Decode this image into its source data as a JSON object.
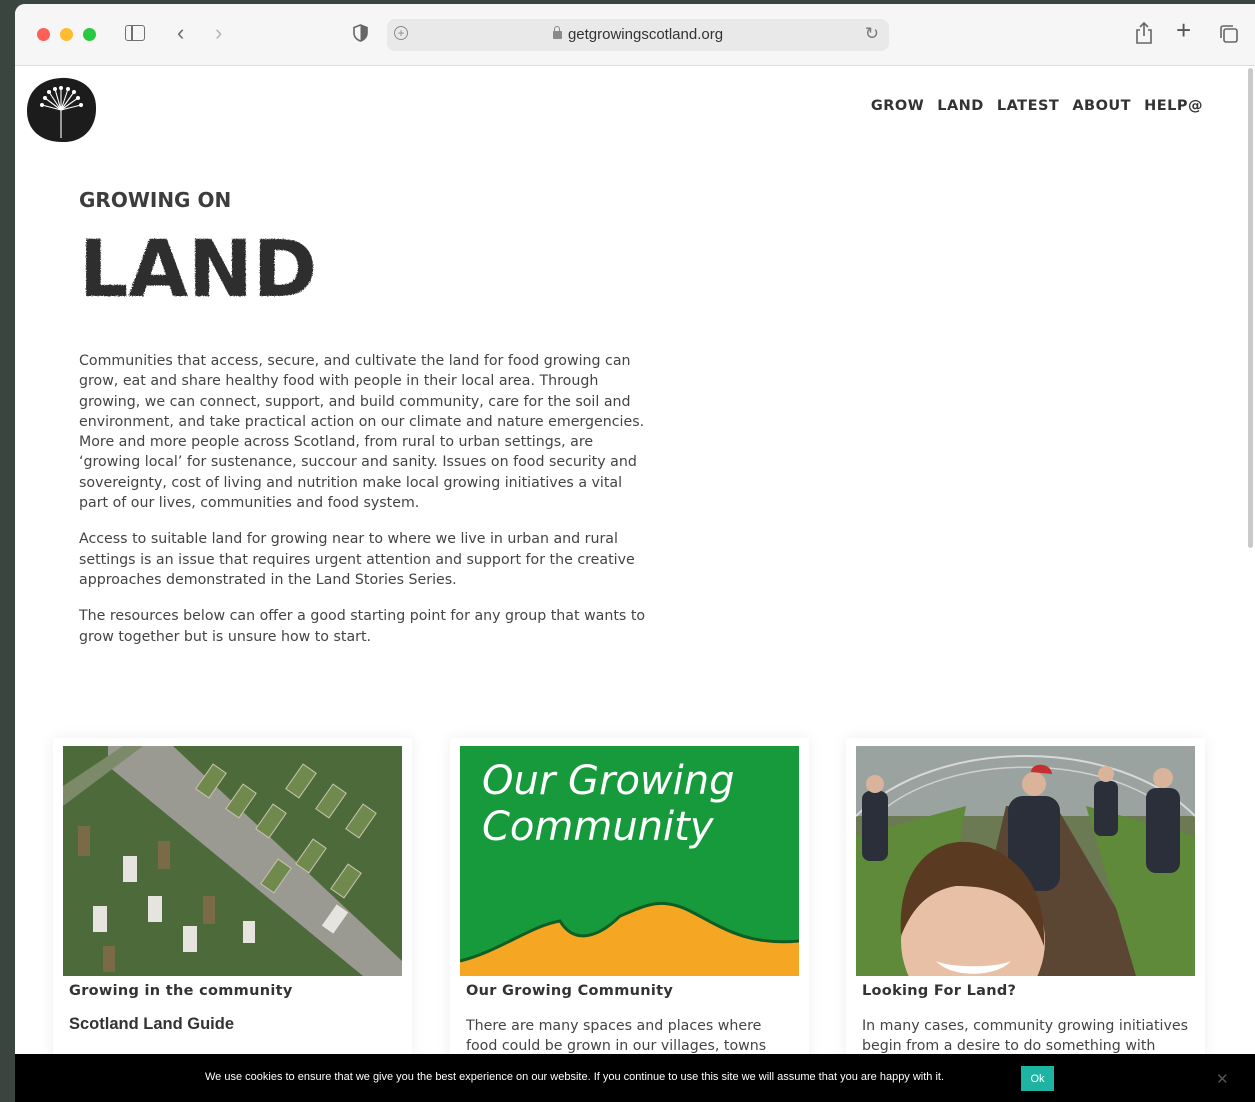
{
  "browser": {
    "url": "getgrowingscotland.org"
  },
  "nav": {
    "items": [
      "GROW",
      "LAND",
      "LATEST",
      "ABOUT",
      "HELP@"
    ]
  },
  "hero": {
    "kicker": "GROWING ON",
    "title": "LAND"
  },
  "intro": {
    "paragraphs": [
      "Communities that access, secure, and cultivate the land for food growing can grow, eat and share healthy food with people in their local area. Through growing, we can connect, support, and build community, care for the soil and environment, and take practical action on our climate and nature emergencies. More and more people across Scotland, from rural to urban settings, are ‘growing local’ for sustenance, succour and sanity. Issues on food security and sovereignty, cost of living and nutrition make local growing initiatives a vital part of our lives, communities and food system.",
      "Access to suitable land for growing near to where we live in urban and rural settings is an issue that requires urgent attention and support for the creative approaches demonstrated in the Land Stories Series.",
      "The resources below can offer a good starting point for any group that wants to grow together but is unsure how to start."
    ]
  },
  "cards": [
    {
      "category": "Growing in the community",
      "subtitle": "Scotland Land Guide"
    },
    {
      "category": "Our Growing Community",
      "image_text_line1": "Our Growing",
      "image_text_line2": "Community",
      "excerpt": "There are many spaces and places where food could be grown in our villages, towns and cities"
    },
    {
      "category": "Looking For Land?",
      "excerpt": "In many cases, community growing initiatives begin from a desire to do something with"
    }
  ],
  "cookie": {
    "message": "We use cookies to ensure that we give you the best experience on our website. If you continue to use this site we will assume that you are happy with it.",
    "ok_label": "Ok",
    "close_label": "✕"
  },
  "colors": {
    "accent": "#1fb3a4",
    "card2_green": "#179a3c",
    "card2_orange": "#f5a623",
    "text": "#444444"
  }
}
